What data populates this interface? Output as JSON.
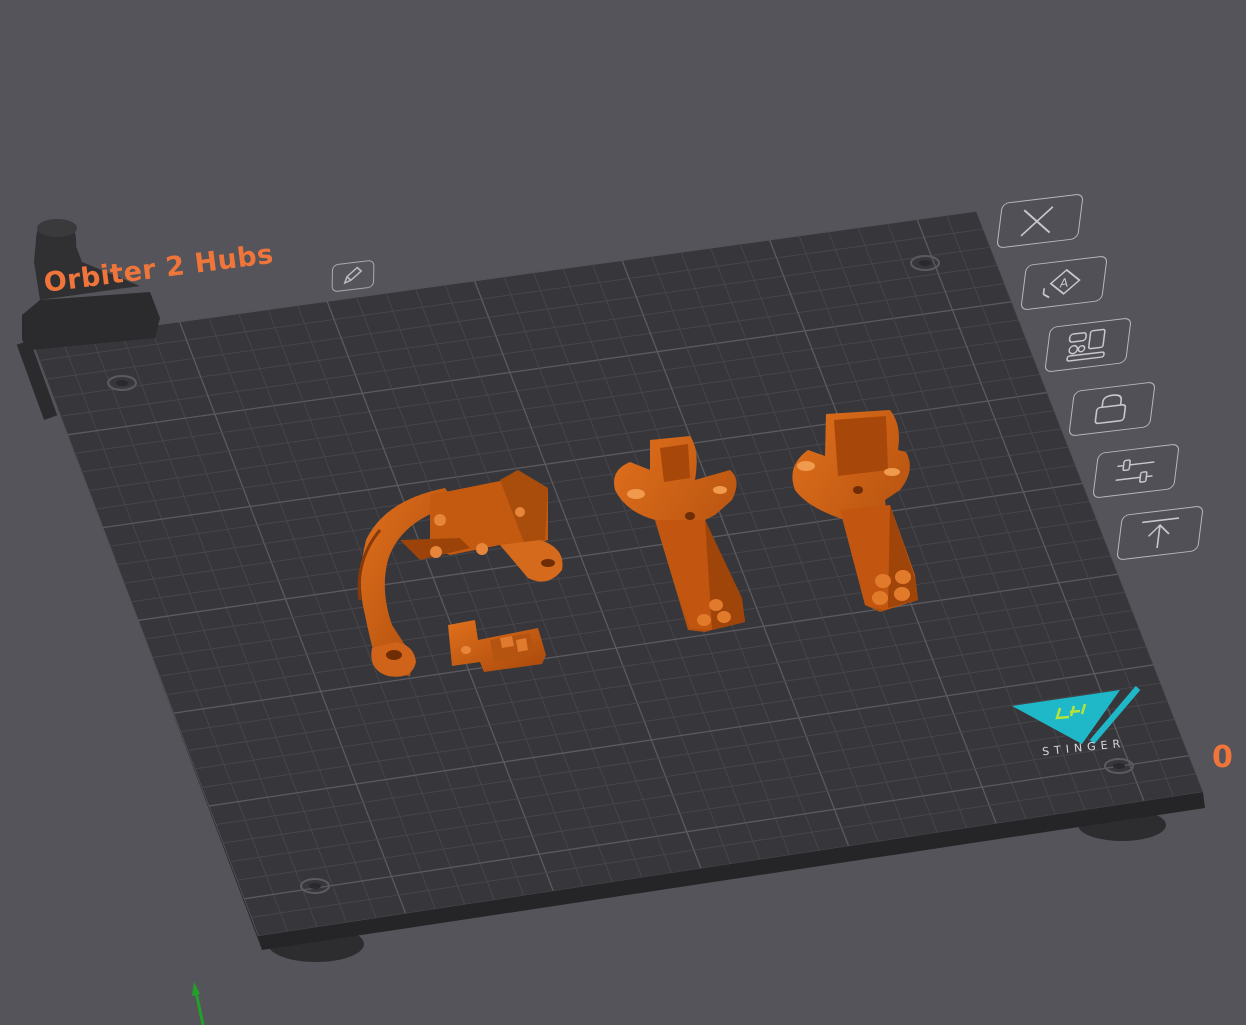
{
  "plate": {
    "name": "Orbiter 2 Hubs",
    "logo_text": "STINGER",
    "offscreen_label": "0"
  },
  "toolbar": [
    {
      "name": "close",
      "icon": "close-icon"
    },
    {
      "name": "auto-orient",
      "icon": "auto-orient-icon"
    },
    {
      "name": "arrange",
      "icon": "arrange-icon"
    },
    {
      "name": "lock",
      "icon": "lock-icon"
    },
    {
      "name": "plate-settings",
      "icon": "sliders-icon"
    },
    {
      "name": "move-to-top",
      "icon": "move-top-icon"
    }
  ],
  "colors": {
    "background": "#55545a",
    "plate": "#37373b",
    "grid": "#4a4a4f",
    "model": "#c4590f",
    "accent": "#f0753a",
    "logo_teal": "#1fb8c9",
    "logo_green": "#b6e33a"
  }
}
